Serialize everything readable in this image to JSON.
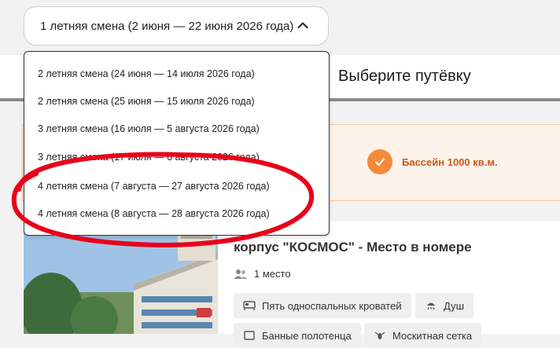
{
  "select": {
    "selected": "1 летняя смена (2 июня — 22 июня 2026 года)",
    "options": [
      "2 летняя смена (24 июня — 14 июля 2026 года)",
      "2 летняя смена (25 июня — 15 июля 2026 года)",
      "3 летняя смена (16 июля — 5 августа 2026 года)",
      "3 летняя смена (17 июля — 6 августа 2026 года)",
      "4 летняя смена (7 августа — 27 августа 2026 года)",
      "4 летняя смена (8 августа — 28 августа 2026 года)"
    ]
  },
  "section": {
    "title": "Выберите путёвку"
  },
  "feature": {
    "text": "Бассейн 1000 кв.м."
  },
  "room": {
    "title": "корпус \"КОСМОС\" - Место в номере",
    "guests": "1 место",
    "amenities": [
      "Пять односпальных кроватей",
      "Душ",
      "Банные полотенца",
      "Москитная сетка"
    ]
  },
  "colors": {
    "accent": "#f28a3a",
    "annotation": "#e8001a"
  }
}
